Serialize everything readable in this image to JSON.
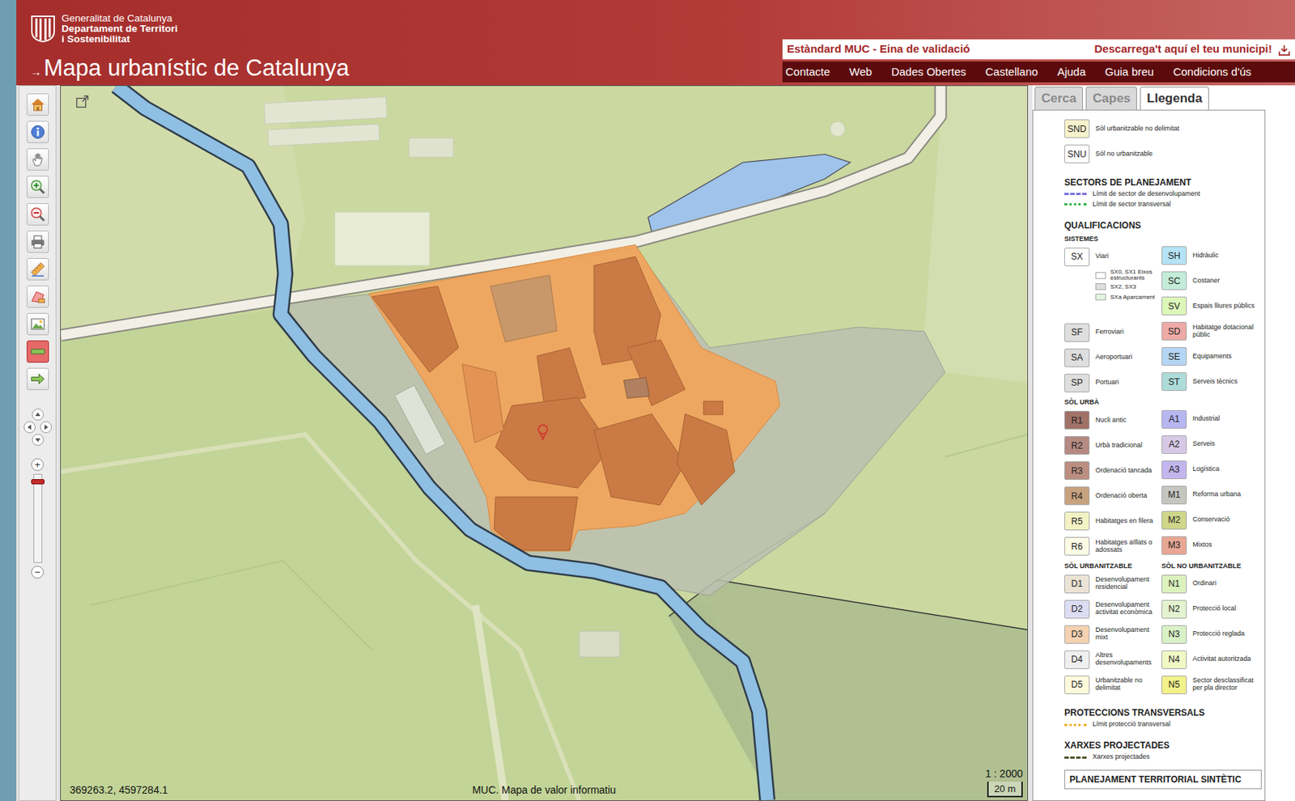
{
  "header": {
    "org_lines": [
      "Generalitat de Catalunya",
      "Departament de Territori",
      "i Sostenibilitat"
    ],
    "arrow": "→",
    "title": "Mapa urbanístic de Catalunya"
  },
  "top_links": [
    "Estàndard MUC - Eina de validació",
    "Descarrega't aquí el teu municipi!"
  ],
  "menu": [
    "Contacte",
    "Web",
    "Dades Obertes",
    "Castellano",
    "Ajuda",
    "Guia breu",
    "Condicions d'ús"
  ],
  "toolbar": {
    "tools": [
      {
        "kind": "home",
        "selected": false
      },
      {
        "kind": "info",
        "selected": false
      },
      {
        "kind": "pan",
        "selected": false
      },
      {
        "kind": "zoomin",
        "selected": false
      },
      {
        "kind": "zoomout",
        "selected": false
      },
      {
        "kind": "print",
        "selected": false
      },
      {
        "kind": "measure",
        "selected": false
      },
      {
        "kind": "area",
        "selected": false
      },
      {
        "kind": "export",
        "selected": false
      },
      {
        "kind": "highlight",
        "selected": true
      },
      {
        "kind": "next",
        "selected": false
      }
    ],
    "zoom_in": "+",
    "zoom_out": "−",
    "zoom_level": 0.95
  },
  "map": {
    "coords": "369263.2, 4597284.1",
    "caption": "MUC. Mapa de valor informatiu",
    "scale": "1 : 2000",
    "scalebar": "20 m"
  },
  "panel": {
    "tabs": [
      {
        "label": "Cerca",
        "selected": false
      },
      {
        "label": "Capes",
        "selected": false
      },
      {
        "label": "Llegenda",
        "selected": true
      }
    ]
  },
  "legend": {
    "classes": [
      {
        "code": "SND",
        "label": "Sòl urbanitzable no delimitat",
        "color": "#f6f2cc"
      },
      {
        "code": "SNU",
        "label": "Sòl no urbanitzable",
        "color": "#ffffff"
      }
    ],
    "sectors": {
      "title": "SECTORS DE PLANEJAMENT",
      "lines": [
        {
          "label": "Límit de sector de desenvolupament",
          "color": "#7a6fe0",
          "kind": "dashed"
        },
        {
          "label": "Límit de sector transversal",
          "color": "#39b54a",
          "kind": "dotted"
        }
      ]
    },
    "qualificacions": {
      "title": "QUALIFICACIONS",
      "groups": [
        {
          "columns": [
            {
              "title": "SISTEMES",
              "items": [
                {
                  "code": "SX",
                  "label": "Viari",
                  "color": "#ffffff",
                  "subitems": [
                    {
                      "label": "SX0, SX1 Eixos estructurants",
                      "color": "#ffffff"
                    },
                    {
                      "label": "SX2, SX3",
                      "color": "#dddddd"
                    },
                    {
                      "label": "SXa Aparcament",
                      "color": "#e2f5dd"
                    }
                  ]
                },
                {
                  "code": "SF",
                  "label": "Ferroviari",
                  "color": "#dedede"
                },
                {
                  "code": "SA",
                  "label": "Aeroportuari",
                  "color": "#dedede"
                },
                {
                  "code": "SP",
                  "label": "Portuari",
                  "color": "#dedede"
                }
              ]
            },
            {
              "items": [
                {
                  "code": "SH",
                  "label": "Hidràulic",
                  "color": "#b5e3f5"
                },
                {
                  "code": "SC",
                  "label": "Costaner",
                  "color": "#c3ecd9"
                },
                {
                  "code": "SV",
                  "label": "Espais lliures públics",
                  "color": "#dcf7b9"
                },
                {
                  "code": "SD",
                  "label": "Habitatge dotacional públic",
                  "color": "#eeaaa6"
                },
                {
                  "code": "SE",
                  "label": "Equipaments",
                  "color": "#b4d6f4"
                },
                {
                  "code": "ST",
                  "label": "Serveis tècnics",
                  "color": "#addcd9"
                }
              ]
            }
          ]
        },
        {
          "columns": [
            {
              "title": "SÒL URBÀ",
              "items": [
                {
                  "code": "R1",
                  "label": "Nucli antic",
                  "color": "#a07268"
                },
                {
                  "code": "R2",
                  "label": "Urbà tradicional",
                  "color": "#b48a82"
                },
                {
                  "code": "R3",
                  "label": "Ordenació tancada",
                  "color": "#bb8e80"
                },
                {
                  "code": "R4",
                  "label": "Ordenació oberta",
                  "color": "#c7a27e"
                },
                {
                  "code": "R5",
                  "label": "Habitatges en filera",
                  "color": "#f2f2c4"
                },
                {
                  "code": "R6",
                  "label": "Habitatges aïllats o adossats",
                  "color": "#fbfbe6"
                }
              ]
            },
            {
              "items": [
                {
                  "code": "A1",
                  "label": "Industrial",
                  "color": "#b6b6f2"
                },
                {
                  "code": "A2",
                  "label": "Serveis",
                  "color": "#d7c9e6"
                },
                {
                  "code": "A3",
                  "label": "Logística",
                  "color": "#c3b6ee"
                },
                {
                  "code": "M1",
                  "label": "Reforma urbana",
                  "color": "#c6c6c0"
                },
                {
                  "code": "M2",
                  "label": "Conservació",
                  "color": "#cfd68a"
                },
                {
                  "code": "M3",
                  "label": "Mixtos",
                  "color": "#e8a694"
                }
              ]
            }
          ]
        },
        {
          "columns": [
            {
              "title": "SÒL URBANITZABLE",
              "items": [
                {
                  "code": "D1",
                  "label": "Desenvolupament residencial",
                  "color": "#ebe3d5"
                },
                {
                  "code": "D2",
                  "label": "Desenvolupament activitat econòmica",
                  "color": "#dcdcf2"
                },
                {
                  "code": "D3",
                  "label": "Desenvolupament mixt",
                  "color": "#f3d1b1"
                },
                {
                  "code": "D4",
                  "label": "Altres desenvolupaments",
                  "color": "#efefef"
                },
                {
                  "code": "D5",
                  "label": "Urbanitzable no delimitat",
                  "color": "#fbfbdc"
                }
              ]
            },
            {
              "title": "SÒL NO URBANITZABLE",
              "items": [
                {
                  "code": "N1",
                  "label": "Ordinari",
                  "color": "#dbf2bd"
                },
                {
                  "code": "N2",
                  "label": "Protecció local",
                  "color": "#e3f2cf"
                },
                {
                  "code": "N3",
                  "label": "Protecció reglada",
                  "color": "#d9f1c6"
                },
                {
                  "code": "N4",
                  "label": "Activitat autoritzada",
                  "color": "#f1f8c6"
                },
                {
                  "code": "N5",
                  "label": "Sector desclassificat per pla director",
                  "color": "#f2f28a"
                }
              ]
            }
          ]
        }
      ]
    },
    "proteccions": {
      "title": "PROTECCIONS TRANSVERSALS",
      "line": {
        "label": "Límit protecció transversal",
        "color": "#f0b030",
        "kind": "dotted"
      }
    },
    "xarxes": {
      "title": "XARXES PROJECTADES",
      "line": {
        "label": "Xarxes projectades",
        "color": "#555533",
        "kind": "dashed"
      }
    },
    "cut_title": "PLANEJAMENT TERRITORIAL SINTÈTIC"
  }
}
